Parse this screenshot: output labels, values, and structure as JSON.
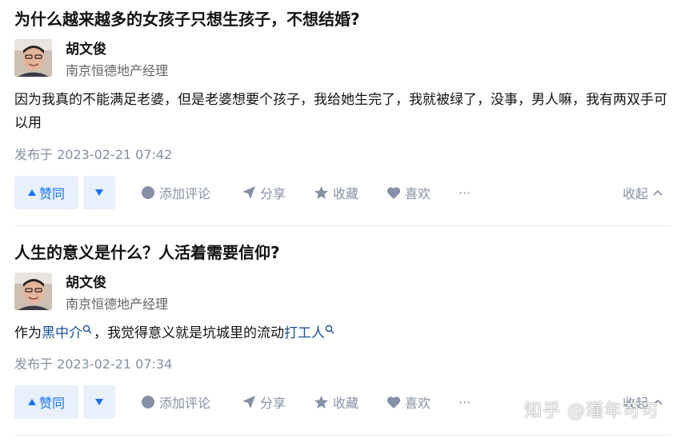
{
  "answers": [
    {
      "question": "为什么越来越多的女孩子只想生孩子，不想结婚?",
      "author": {
        "name": "胡文俊",
        "bio": "南京恒德地产经理"
      },
      "content": "因为我真的不能满足老婆，但是老婆想要个孩子，我给她生完了，我就被绿了，没事，男人嘛，我有两双手可以用",
      "published": "发布于 2023-02-21 07:42",
      "actions": {
        "upvote": "赞同",
        "comment": "添加评论",
        "share": "分享",
        "favorite": "收藏",
        "like": "喜欢",
        "more": "···",
        "collapse": "收起"
      }
    },
    {
      "question": "人生的意义是什么？人活着需要信仰?",
      "author": {
        "name": "胡文俊",
        "bio": "南京恒德地产经理"
      },
      "content_parts": {
        "before": "作为",
        "link1": "黑中介",
        "middle": "，我觉得意义就是坑城里的流动",
        "link2": "打工人"
      },
      "published": "发布于 2023-02-21 07:34",
      "actions": {
        "upvote": "赞同",
        "comment": "添加评论",
        "share": "分享",
        "favorite": "收藏",
        "like": "喜欢",
        "more": "···",
        "collapse": "收起"
      }
    }
  ],
  "watermark": "知乎 @瑾年可可",
  "colors": {
    "accent": "#1772f6",
    "meta": "#8590a6",
    "link": "#175199",
    "vote_bg": "#e8f0fb"
  }
}
